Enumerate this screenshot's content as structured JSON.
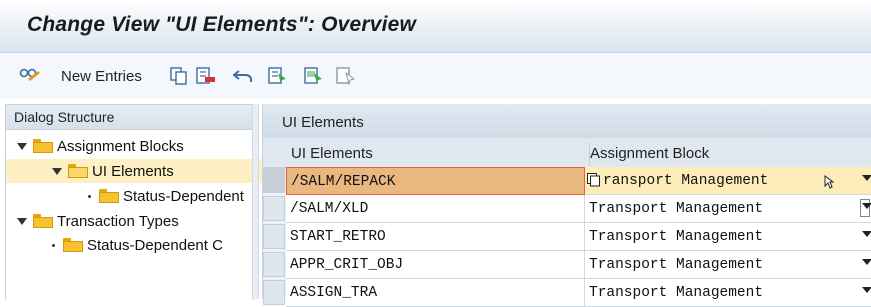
{
  "window": {
    "title": "Change View \"UI Elements\": Overview"
  },
  "toolbar": {
    "new_entries_label": "New Entries"
  },
  "dialog_structure": {
    "header": "Dialog Structure",
    "items": [
      {
        "label": "Assignment Blocks"
      },
      {
        "label": "UI Elements"
      },
      {
        "label": "Status-Dependent"
      },
      {
        "label": "Transaction Types"
      },
      {
        "label": "Status-Dependent C"
      }
    ]
  },
  "main": {
    "header": "UI Elements",
    "columns": [
      "UI Elements",
      "Assignment Block"
    ],
    "rows": [
      {
        "ui_element": "/SALM/REPACK",
        "assignment_block": "ransport Management"
      },
      {
        "ui_element": "/SALM/XLD",
        "assignment_block": "Transport Management"
      },
      {
        "ui_element": "START_RETRO",
        "assignment_block": "Transport Management"
      },
      {
        "ui_element": "APPR_CRIT_OBJ",
        "assignment_block": "Transport Management"
      },
      {
        "ui_element": "ASSIGN_TRA",
        "assignment_block": "Transport Management"
      }
    ]
  },
  "icons": [
    "glasses-icon",
    "copy-icon",
    "delete-icon",
    "undo-icon",
    "select-all-icon",
    "select-block-icon",
    "deselect-all-icon"
  ],
  "colors": {
    "selected_tree": "#fdf0c4",
    "focused_cell": "#e9b77f",
    "focused_row": "#fdedb8",
    "folder": "#f7c230"
  }
}
